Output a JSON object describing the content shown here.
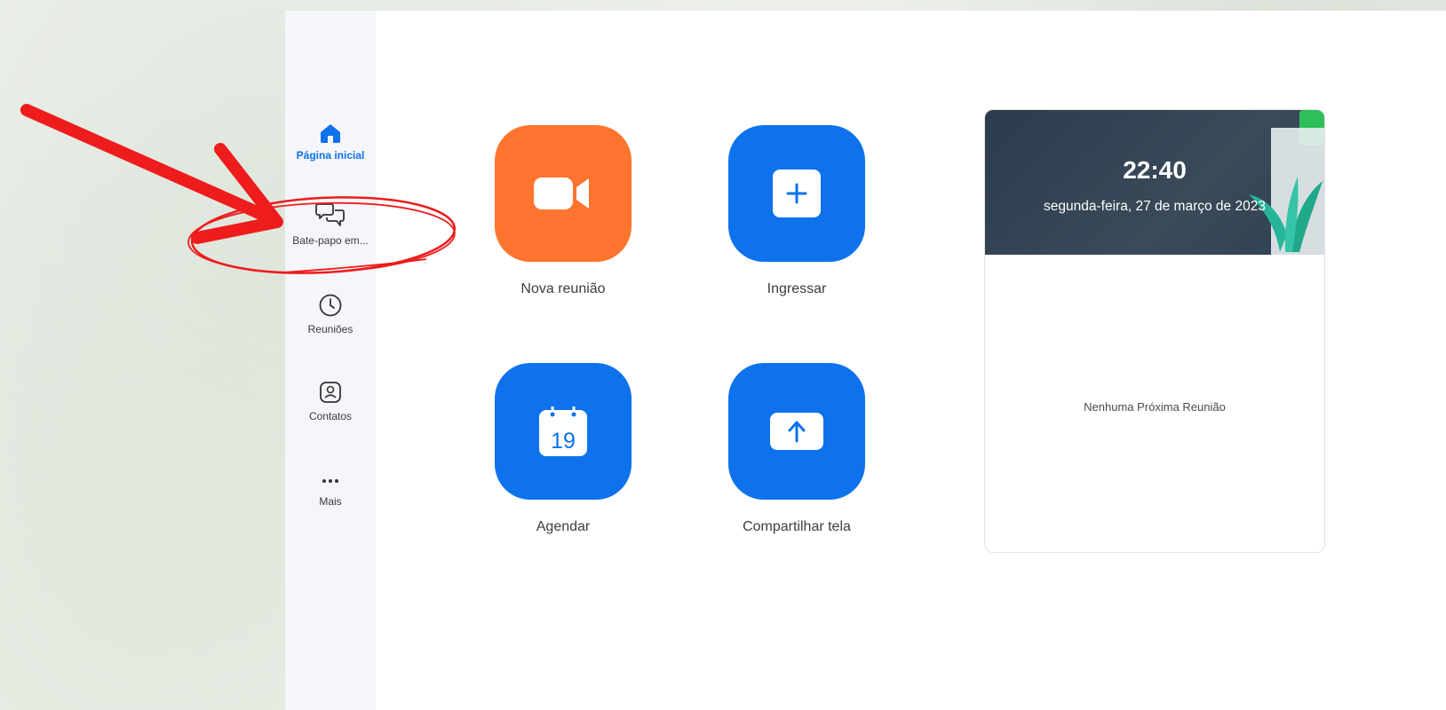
{
  "sidebar": {
    "items": [
      {
        "label": "Página inicial",
        "icon": "home-icon",
        "active": true
      },
      {
        "label": "Bate-papo em...",
        "icon": "chat-bubbles-icon",
        "active": false
      },
      {
        "label": "Reuniões",
        "icon": "clock-icon",
        "active": false
      },
      {
        "label": "Contatos",
        "icon": "contact-card-icon",
        "active": false
      },
      {
        "label": "Mais",
        "icon": "more-dots-icon",
        "active": false
      }
    ]
  },
  "actions": [
    {
      "label": "Nova reunião",
      "icon": "video-camera-icon",
      "color": "#ff742e"
    },
    {
      "label": "Ingressar",
      "icon": "plus-icon",
      "color": "#0e72ed"
    },
    {
      "label": "Agendar",
      "icon": "calendar-icon",
      "calendar_day": "19",
      "color": "#0e72ed"
    },
    {
      "label": "Compartilhar tela",
      "icon": "share-up-arrow-icon",
      "color": "#0e72ed"
    }
  ],
  "upcoming": {
    "time": "22:40",
    "date": "segunda-feira, 27 de março de 2023",
    "empty_text": "Nenhuma Próxima Reunião"
  },
  "colors": {
    "accent_blue": "#0e72ed",
    "accent_orange": "#ff742e",
    "annotation_red": "#ee1c1c"
  }
}
